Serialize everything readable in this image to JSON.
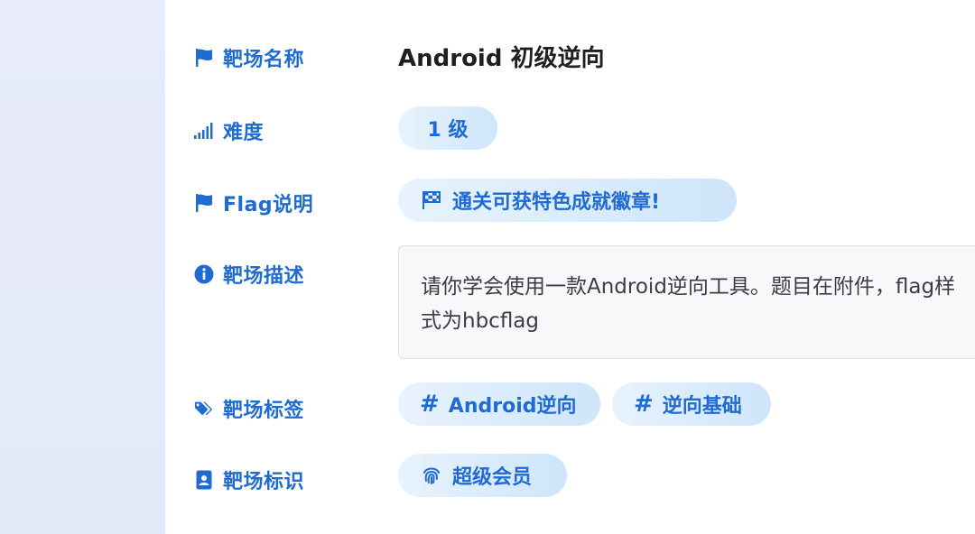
{
  "fields": {
    "name": {
      "label": "靶场名称",
      "value": "Android 初级逆向",
      "icon": "flag-icon"
    },
    "difficulty": {
      "label": "难度",
      "value": "1 级",
      "icon": "signal-icon"
    },
    "flag": {
      "label": "Flag说明",
      "value": "通关可获特色成就徽章!",
      "icon": "flag-icon",
      "pill_icon": "checkered-flag-icon"
    },
    "description": {
      "label": "靶场描述",
      "value": "请你学会使用一款Android逆向工具。题目在附件，flag样式为hbcflag",
      "icon": "info-icon"
    },
    "tags": {
      "label": "靶场标签",
      "icon": "tags-icon",
      "items": [
        "Android逆向",
        "逆向基础"
      ],
      "item_icon": "hash-icon"
    },
    "identity": {
      "label": "靶场标识",
      "value": "超级会员",
      "icon": "id-badge-icon",
      "pill_icon": "fingerprint-icon"
    }
  },
  "colors": {
    "accent": "#1f6bd1",
    "pill_bg": "#dbecfc",
    "left_panel": "#e6eafb"
  }
}
